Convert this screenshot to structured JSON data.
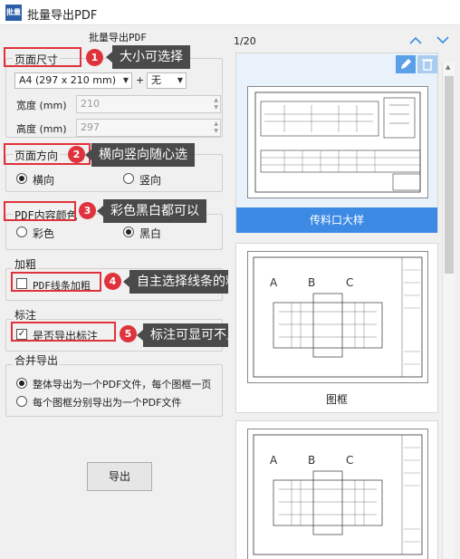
{
  "window": {
    "icon_label": "批量",
    "title": "批量导出PDF"
  },
  "panel": {
    "title": "批量导出PDF"
  },
  "page_size": {
    "label": "页面尺寸",
    "paper_value": "A4 (297 x 210 mm)",
    "orientation_select": "无",
    "plus_label": "+",
    "width_label": "宽度 (mm)",
    "width_value": "210",
    "height_label": "高度 (mm)",
    "height_value": "297"
  },
  "orientation": {
    "label": "页面方向",
    "landscape": "横向",
    "portrait": "竖向",
    "selected": "横向"
  },
  "color": {
    "label": "PDF内容颜色",
    "colored": "彩色",
    "bw": "黑白",
    "selected": "黑白"
  },
  "bold": {
    "label": "加粗",
    "checkbox": "PDF线条加粗",
    "checked": false
  },
  "annotation": {
    "label": "标注",
    "checkbox": "是否导出标注",
    "checked": true
  },
  "merge": {
    "label": "合并导出",
    "opt1": "整体导出为一个PDF文件，每个图框一页",
    "opt2": "每个图框分别导出为一个PDF文件",
    "selected": "opt1"
  },
  "export_button": "导出",
  "callouts": [
    {
      "num": "1",
      "text": "大小可选择"
    },
    {
      "num": "2",
      "text": "横向竖向随心选"
    },
    {
      "num": "3",
      "text": "彩色黑白都可以"
    },
    {
      "num": "4",
      "text": "自主选择线条的粗细"
    },
    {
      "num": "5",
      "text": "标注可显可不显"
    }
  ],
  "preview": {
    "page_indicator": "1/20",
    "cards": [
      {
        "caption": "传料口大样",
        "selected": true
      },
      {
        "caption": "图框",
        "selected": false
      },
      {
        "caption": "",
        "selected": false
      }
    ]
  },
  "colors": {
    "accent": "#e0323c",
    "callout_bg": "#4a4a4a",
    "selected_caption_bg": "#3d8ae4",
    "chevron": "#3d8ae4"
  }
}
